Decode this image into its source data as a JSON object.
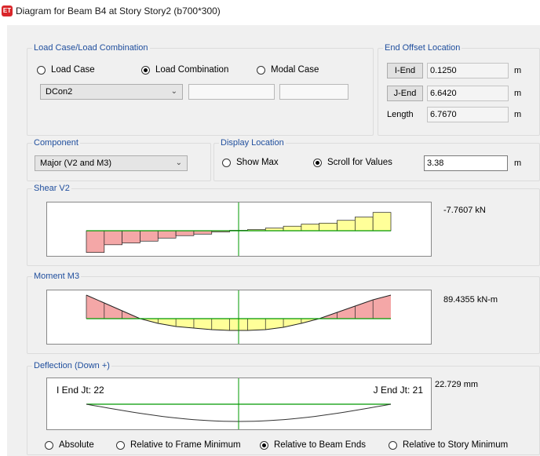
{
  "window": {
    "title": "Diagram for Beam B4 at Story Story2 (b700*300)",
    "icon": "ET"
  },
  "load_case": {
    "group_label": "Load Case/Load Combination",
    "options": [
      "Load Case",
      "Load Combination",
      "Modal Case"
    ],
    "selected_index": 1,
    "combo_value": "DCon2"
  },
  "end_offset": {
    "group_label": "End Offset Location",
    "i_end_label": "I-End",
    "i_end_value": "0.1250",
    "j_end_label": "J-End",
    "j_end_value": "6.6420",
    "length_label": "Length",
    "length_value": "6.7670",
    "unit": "m"
  },
  "component": {
    "group_label": "Component",
    "value": "Major (V2 and M3)"
  },
  "display_location": {
    "group_label": "Display Location",
    "show_max": "Show Max",
    "scroll_values": "Scroll for Values",
    "selected": "scroll",
    "value": "3.38",
    "unit": "m"
  },
  "shear": {
    "group_label": "Shear V2",
    "readout": "-7.7607 kN",
    "values": [
      -29.6,
      -19.1,
      -16.7,
      -14.2,
      -10.0,
      -6.7,
      -4.6,
      -1.6,
      0.6,
      1.6,
      3.7,
      6.2,
      9.1,
      10.4,
      14.2,
      18.7,
      25.0
    ]
  },
  "moment": {
    "group_label": "Moment M3",
    "readout": "89.4355 kN-m",
    "values": [
      30,
      20,
      10,
      0,
      -6,
      -10,
      -12,
      -14,
      -15,
      -15,
      -14,
      -11,
      -6,
      0,
      8,
      16,
      24,
      30
    ]
  },
  "deflection": {
    "group_label": "Deflection (Down +)",
    "readout": "22.729 mm",
    "i_end_label": "I End Jt: 22",
    "j_end_label": "J End Jt: 21",
    "options": [
      "Absolute",
      "Relative to Frame Minimum",
      "Relative to Beam Ends",
      "Relative to Story Minimum"
    ],
    "selected_index": 2
  },
  "colors": {
    "negative_fill": "#f4a7a7",
    "positive_fill": "#ffff99",
    "axis_line": "#009900",
    "marker_line": "#009900"
  }
}
